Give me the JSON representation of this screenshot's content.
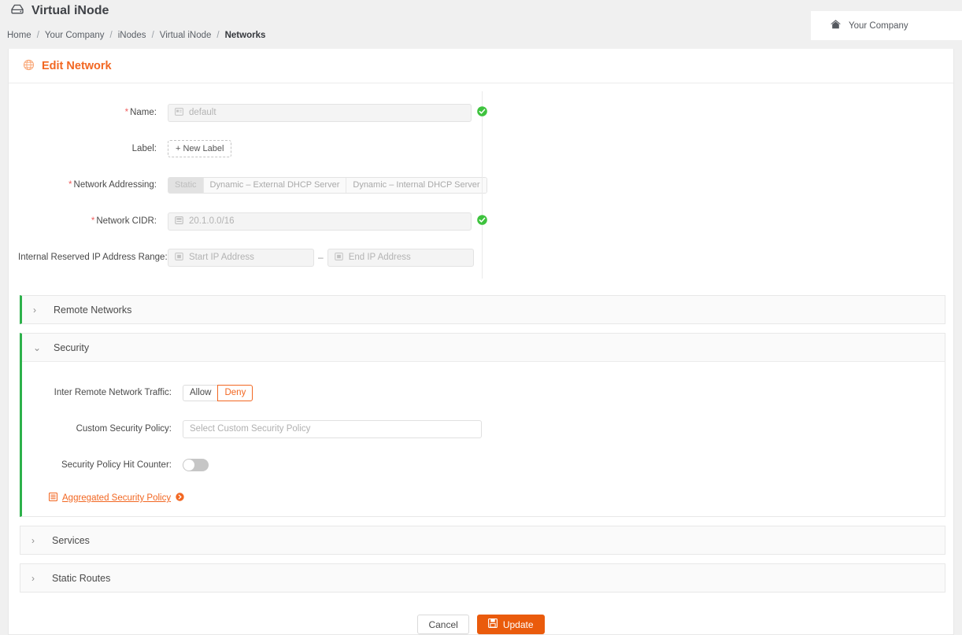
{
  "app": {
    "title": "Virtual iNode",
    "title_icon": "inode-device-icon"
  },
  "breadcrumb": {
    "separator": "/",
    "items": [
      {
        "label": "Home",
        "current": false
      },
      {
        "label": "Your Company",
        "current": false
      },
      {
        "label": "iNodes",
        "current": false
      },
      {
        "label": "Virtual iNode",
        "current": false
      },
      {
        "label": "Networks",
        "current": true
      }
    ]
  },
  "company": {
    "icon": "home-icon",
    "label": "Your Company"
  },
  "page": {
    "header_icon": "network-globe-icon",
    "header_title": "Edit Network"
  },
  "form": {
    "name": {
      "label": "Name",
      "required": true,
      "icon": "name-badge-icon",
      "value": "default",
      "placeholder": "default",
      "status": "valid"
    },
    "label_field": {
      "label": "Label",
      "required": false,
      "button": "+ New Label"
    },
    "network_addressing": {
      "label": "Network Addressing",
      "required": true,
      "options": [
        {
          "label": "Static",
          "selected": true
        },
        {
          "label": "Dynamic – External DHCP Server",
          "selected": false
        },
        {
          "label": "Dynamic – Internal DHCP Server",
          "selected": false
        }
      ]
    },
    "network_cidr": {
      "label": "Network CIDR",
      "required": true,
      "icon": "cidr-box-icon",
      "value": "20.1.0.0/16",
      "status": "valid"
    },
    "reserved_range": {
      "label": "Internal Reserved IP Address Range",
      "required": false,
      "start_icon": "ip-address-icon",
      "start_placeholder": "Start IP Address",
      "start_value": "",
      "dash": "–",
      "end_icon": "ip-address-icon",
      "end_placeholder": "End IP Address",
      "end_value": ""
    }
  },
  "sections": [
    {
      "name": "remote-networks",
      "title": "Remote Networks",
      "expanded": false,
      "chevron": "›",
      "accent": true
    },
    {
      "name": "security",
      "title": "Security",
      "expanded": true,
      "chevron": "⌄",
      "accent": true
    },
    {
      "name": "services",
      "title": "Services",
      "expanded": false,
      "chevron": "›",
      "accent": false
    },
    {
      "name": "static-routes",
      "title": "Static Routes",
      "expanded": false,
      "chevron": "›",
      "accent": false
    }
  ],
  "security": {
    "inter_remote_traffic": {
      "label": "Inter Remote Network Traffic",
      "options": [
        {
          "label": "Allow",
          "selected": false
        },
        {
          "label": "Deny",
          "selected": true
        }
      ]
    },
    "custom_security_policy": {
      "label": "Custom Security Policy",
      "placeholder": "Select Custom Security Policy",
      "value": ""
    },
    "hit_counter": {
      "label": "Security Policy Hit Counter",
      "enabled": false
    },
    "aggregated_link": {
      "leading_icon": "policy-list-icon",
      "label": "Aggregated Security Policy",
      "trailing_icon": "arrow-circle-right-icon"
    }
  },
  "footer": {
    "cancel": "Cancel",
    "update": "Update",
    "update_icon": "save-disk-icon"
  },
  "colors": {
    "accent_orange": "#f26722",
    "button_orange": "#ea5b0c",
    "accent_green": "#2db14b",
    "valid_green": "#3ec33e",
    "required_red": "#f06060"
  }
}
